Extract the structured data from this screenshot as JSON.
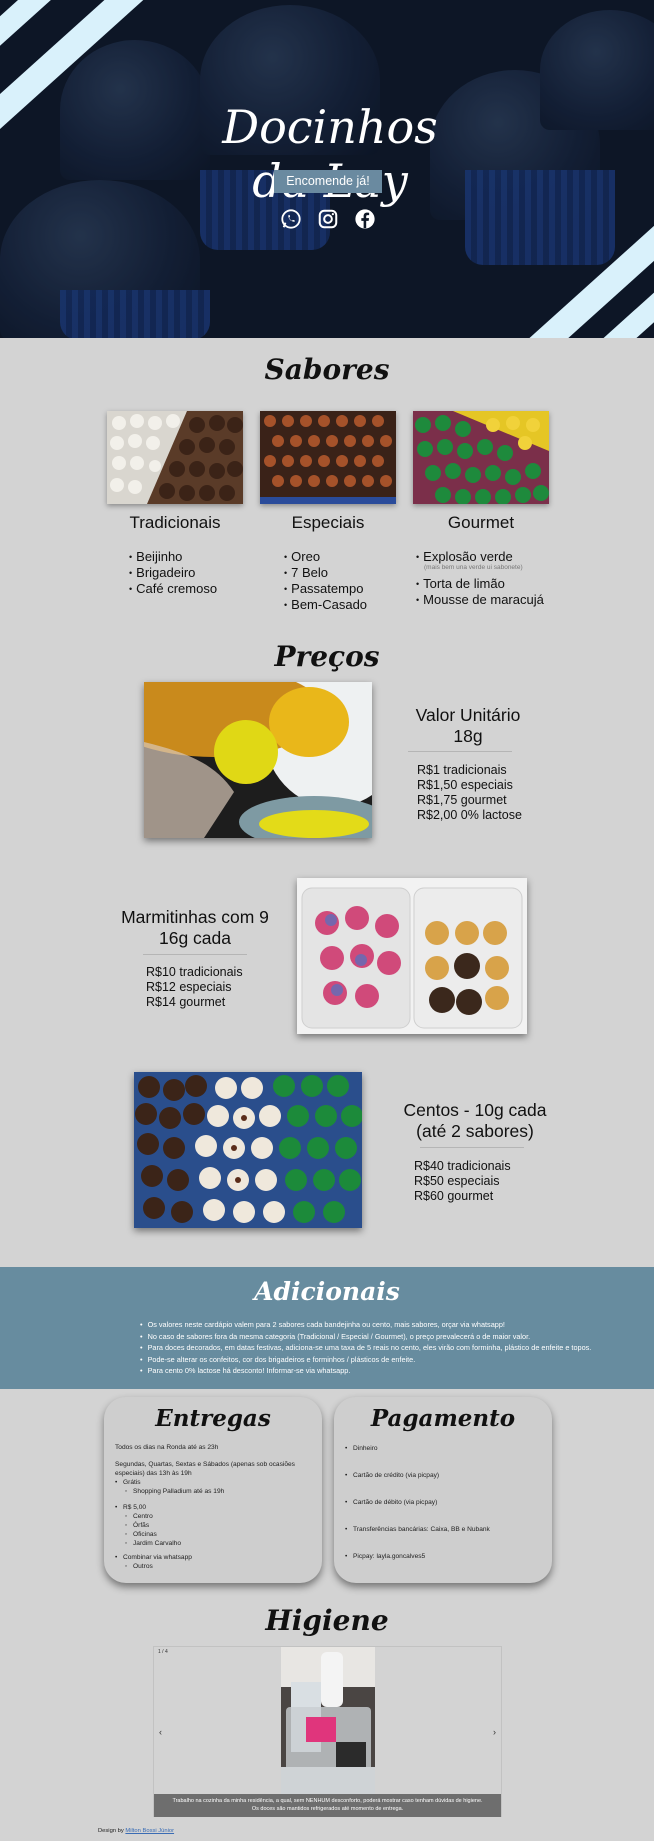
{
  "hero": {
    "logo_text": "Docinhos da Lay",
    "order_button": "Encomende já!",
    "social_icons": [
      "whatsapp-icon",
      "instagram-icon",
      "facebook-icon"
    ]
  },
  "flavors": {
    "title": "Sabores",
    "columns": [
      {
        "title": "Tradicionais",
        "items": [
          "Beijinho",
          "Brigadeiro",
          "Café cremoso"
        ]
      },
      {
        "title": "Especiais",
        "items": [
          "Oreo",
          "7 Belo",
          "Passatempo",
          "Bem-Casado"
        ]
      },
      {
        "title": "Gourmet",
        "items": [
          "Explosão verde",
          "Torta de limão",
          "Mousse de maracujá"
        ],
        "note": "(mais bem una verde ui sabonete)"
      }
    ]
  },
  "prices": {
    "title": "Preços",
    "blocks": [
      {
        "title": "Valor Unitário 18g",
        "lines": [
          "R$1 tradicionais",
          "R$1,50 especiais",
          "R$1,75 gourmet",
          "R$2,00 0% lactose"
        ]
      },
      {
        "title": "Marmitinhas com 9 16g cada",
        "lines": [
          "R$10 tradicionais",
          "R$12 especiais",
          "R$14 gourmet"
        ]
      },
      {
        "title": "Centos - 10g cada (até 2 sabores)",
        "lines": [
          "R$40 tradicionais",
          "R$50 especiais",
          "R$60 gourmet"
        ]
      }
    ]
  },
  "extras": {
    "title": "Adicionais",
    "items": [
      "Os valores neste cardápio valem para 2 sabores cada bandejinha ou cento, mais sabores, orçar via whatsapp!",
      "No caso de sabores fora da mesma categoria (Tradicional / Especial / Gourmet), o preço prevalecerá o de maior valor.",
      "Para doces decorados, em datas festivas, adiciona-se uma taxa de 5 reais no cento, eles virão com forminha, plástico de enfeite e topos.",
      "Pode-se alterar os confeitos, cor dos brigadeiros e forminhos / plásticos de enfeite.",
      "Para cento 0% lactose há desconto! Informar-se via whatsapp."
    ]
  },
  "delivery": {
    "title": "Entregas",
    "line1": "Todos os dias na Ronda até as 23h",
    "line2": "Segundas, Quartas, Sextas e Sábados (apenas sob ocasiões especiais) das 13h às 19h",
    "groups": [
      {
        "label": "Grátis",
        "subs": [
          "Shopping Palladium até as 19h"
        ]
      },
      {
        "label": "R$ 5,00",
        "subs": [
          "Centro",
          "Órfãs",
          "Oficinas",
          "Jardim Carvalho"
        ]
      },
      {
        "label": "Combinar via whatsapp",
        "subs": [
          "Outros"
        ]
      }
    ]
  },
  "payment": {
    "title": "Pagamento",
    "items": [
      "Dinheiro",
      "Cartão de crédito (via picpay)",
      "Cartão de débito (via picpay)",
      "Transferências bancárias: Caixa, BB e Nubank",
      "Picpay: layla.goncalves5"
    ]
  },
  "hygiene": {
    "title": "Higiene",
    "slide_counter": "1 / 4",
    "prev": "‹",
    "next": "›",
    "caption_line1": "Trabalho na cozinha da minha residência, a qual, sem NENHUM desconforto, poderá mostrar caso tenham dúvidas de higiene.",
    "caption_line2": "Os doces são mantidos refrigerados até momento de entrega."
  },
  "footer": {
    "prefix": "Design by",
    "author": "Milton Bossi Júnior"
  },
  "colors": {
    "page_bg": "#d3d3d3",
    "hero_bg": "#0e1726",
    "accent_blue": "#678c9f",
    "stripe": "#d9f1fb",
    "button": "#6a8aa0"
  }
}
